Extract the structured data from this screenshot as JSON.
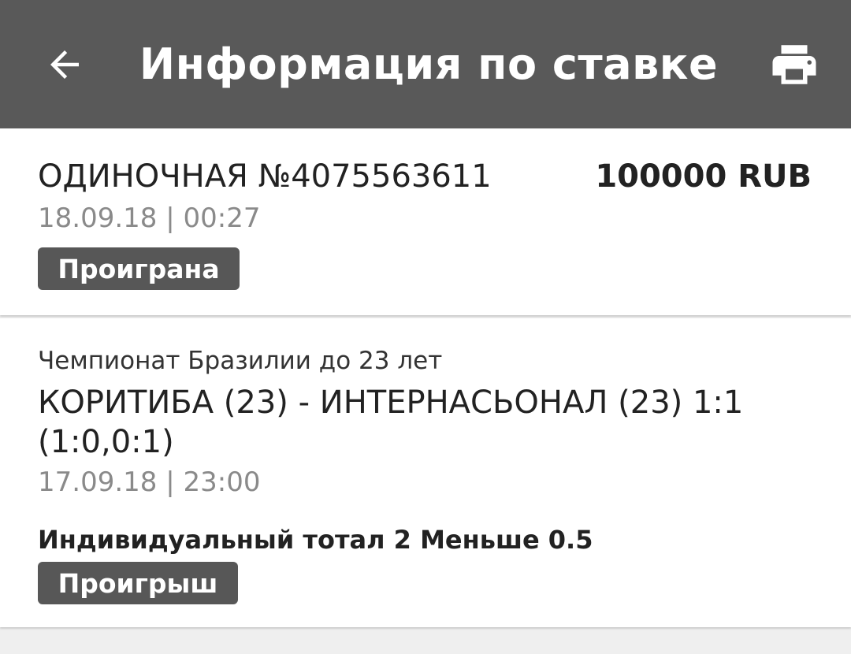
{
  "header": {
    "title": "Информация по ставке",
    "back_icon": "arrow-left-icon",
    "print_icon": "printer-icon",
    "background_color": "#595959"
  },
  "bet": {
    "type_number": "ОДИНОЧНАЯ №4075563611",
    "amount": "100000 RUB",
    "datetime": "18.09.18 | 00:27",
    "status": "Проиграна"
  },
  "event": {
    "league": "Чемпионат Бразилии до 23 лет",
    "match": "КОРИТИБА (23) - ИНТЕРНАСЬОНАЛ (23) 1:1 (1:0,0:1)",
    "datetime": "17.09.18 | 23:00",
    "market": "Индивидуальный тотал 2 Меньше 0.5",
    "result": "Проигрыш"
  }
}
